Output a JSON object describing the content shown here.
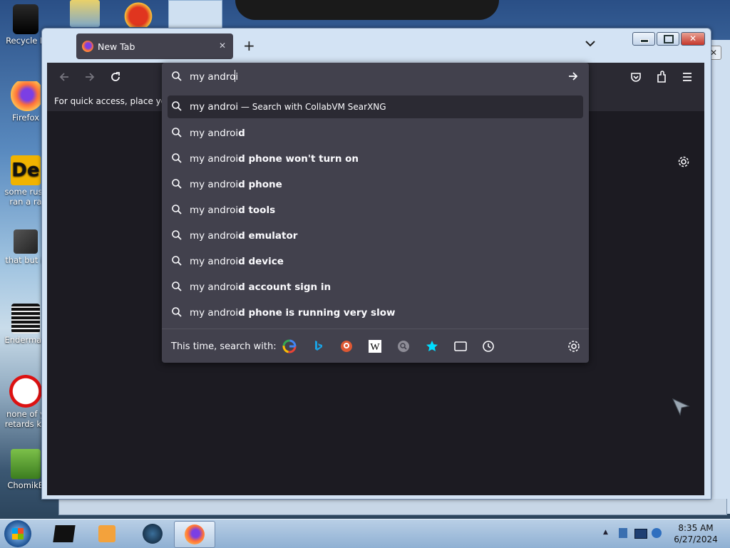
{
  "desktop": {
    "icons": [
      {
        "label": "Recycle B"
      },
      {
        "label": "Firefox"
      },
      {
        "label": "some russ ran a ra"
      },
      {
        "label": "that but it"
      },
      {
        "label": "Enderman"
      },
      {
        "label": "none of y retards kn"
      },
      {
        "label": "ChomikB"
      }
    ]
  },
  "browser": {
    "tab": {
      "title": "New Tab",
      "close": "✕",
      "new_tab": "+"
    },
    "bookmarks_hint": "For quick access, place your b",
    "urlbar": {
      "value": "my androi",
      "suggestions": [
        {
          "typed": "my androi",
          "rest": "",
          "note_sep": " — ",
          "note": "Search with CollabVM SearXNG"
        },
        {
          "typed": "my androi",
          "rest": "d"
        },
        {
          "typed": "my androi",
          "rest": "d phone won't turn on"
        },
        {
          "typed": "my androi",
          "rest": "d phone"
        },
        {
          "typed": "my androi",
          "rest": "d tools"
        },
        {
          "typed": "my androi",
          "rest": "d emulator"
        },
        {
          "typed": "my androi",
          "rest": "d device"
        },
        {
          "typed": "my androi",
          "rest": "d account sign in"
        },
        {
          "typed": "my androi",
          "rest": "d phone is running very slow"
        }
      ],
      "search_with_label": "This time, search with:",
      "engines": [
        "google-icon",
        "bing-icon",
        "duckduckgo-icon",
        "wikipedia-icon",
        "searxng-icon",
        "bookmarks-star-icon",
        "tabs-icon",
        "history-clock-icon"
      ]
    }
  },
  "taskbar": {
    "time": "8:35 AM",
    "date": "6/27/2024"
  },
  "colors": {
    "accent": "#00ddff",
    "panel": "#42414d",
    "toolbar": "#2b2a33",
    "content": "#1c1b22"
  }
}
